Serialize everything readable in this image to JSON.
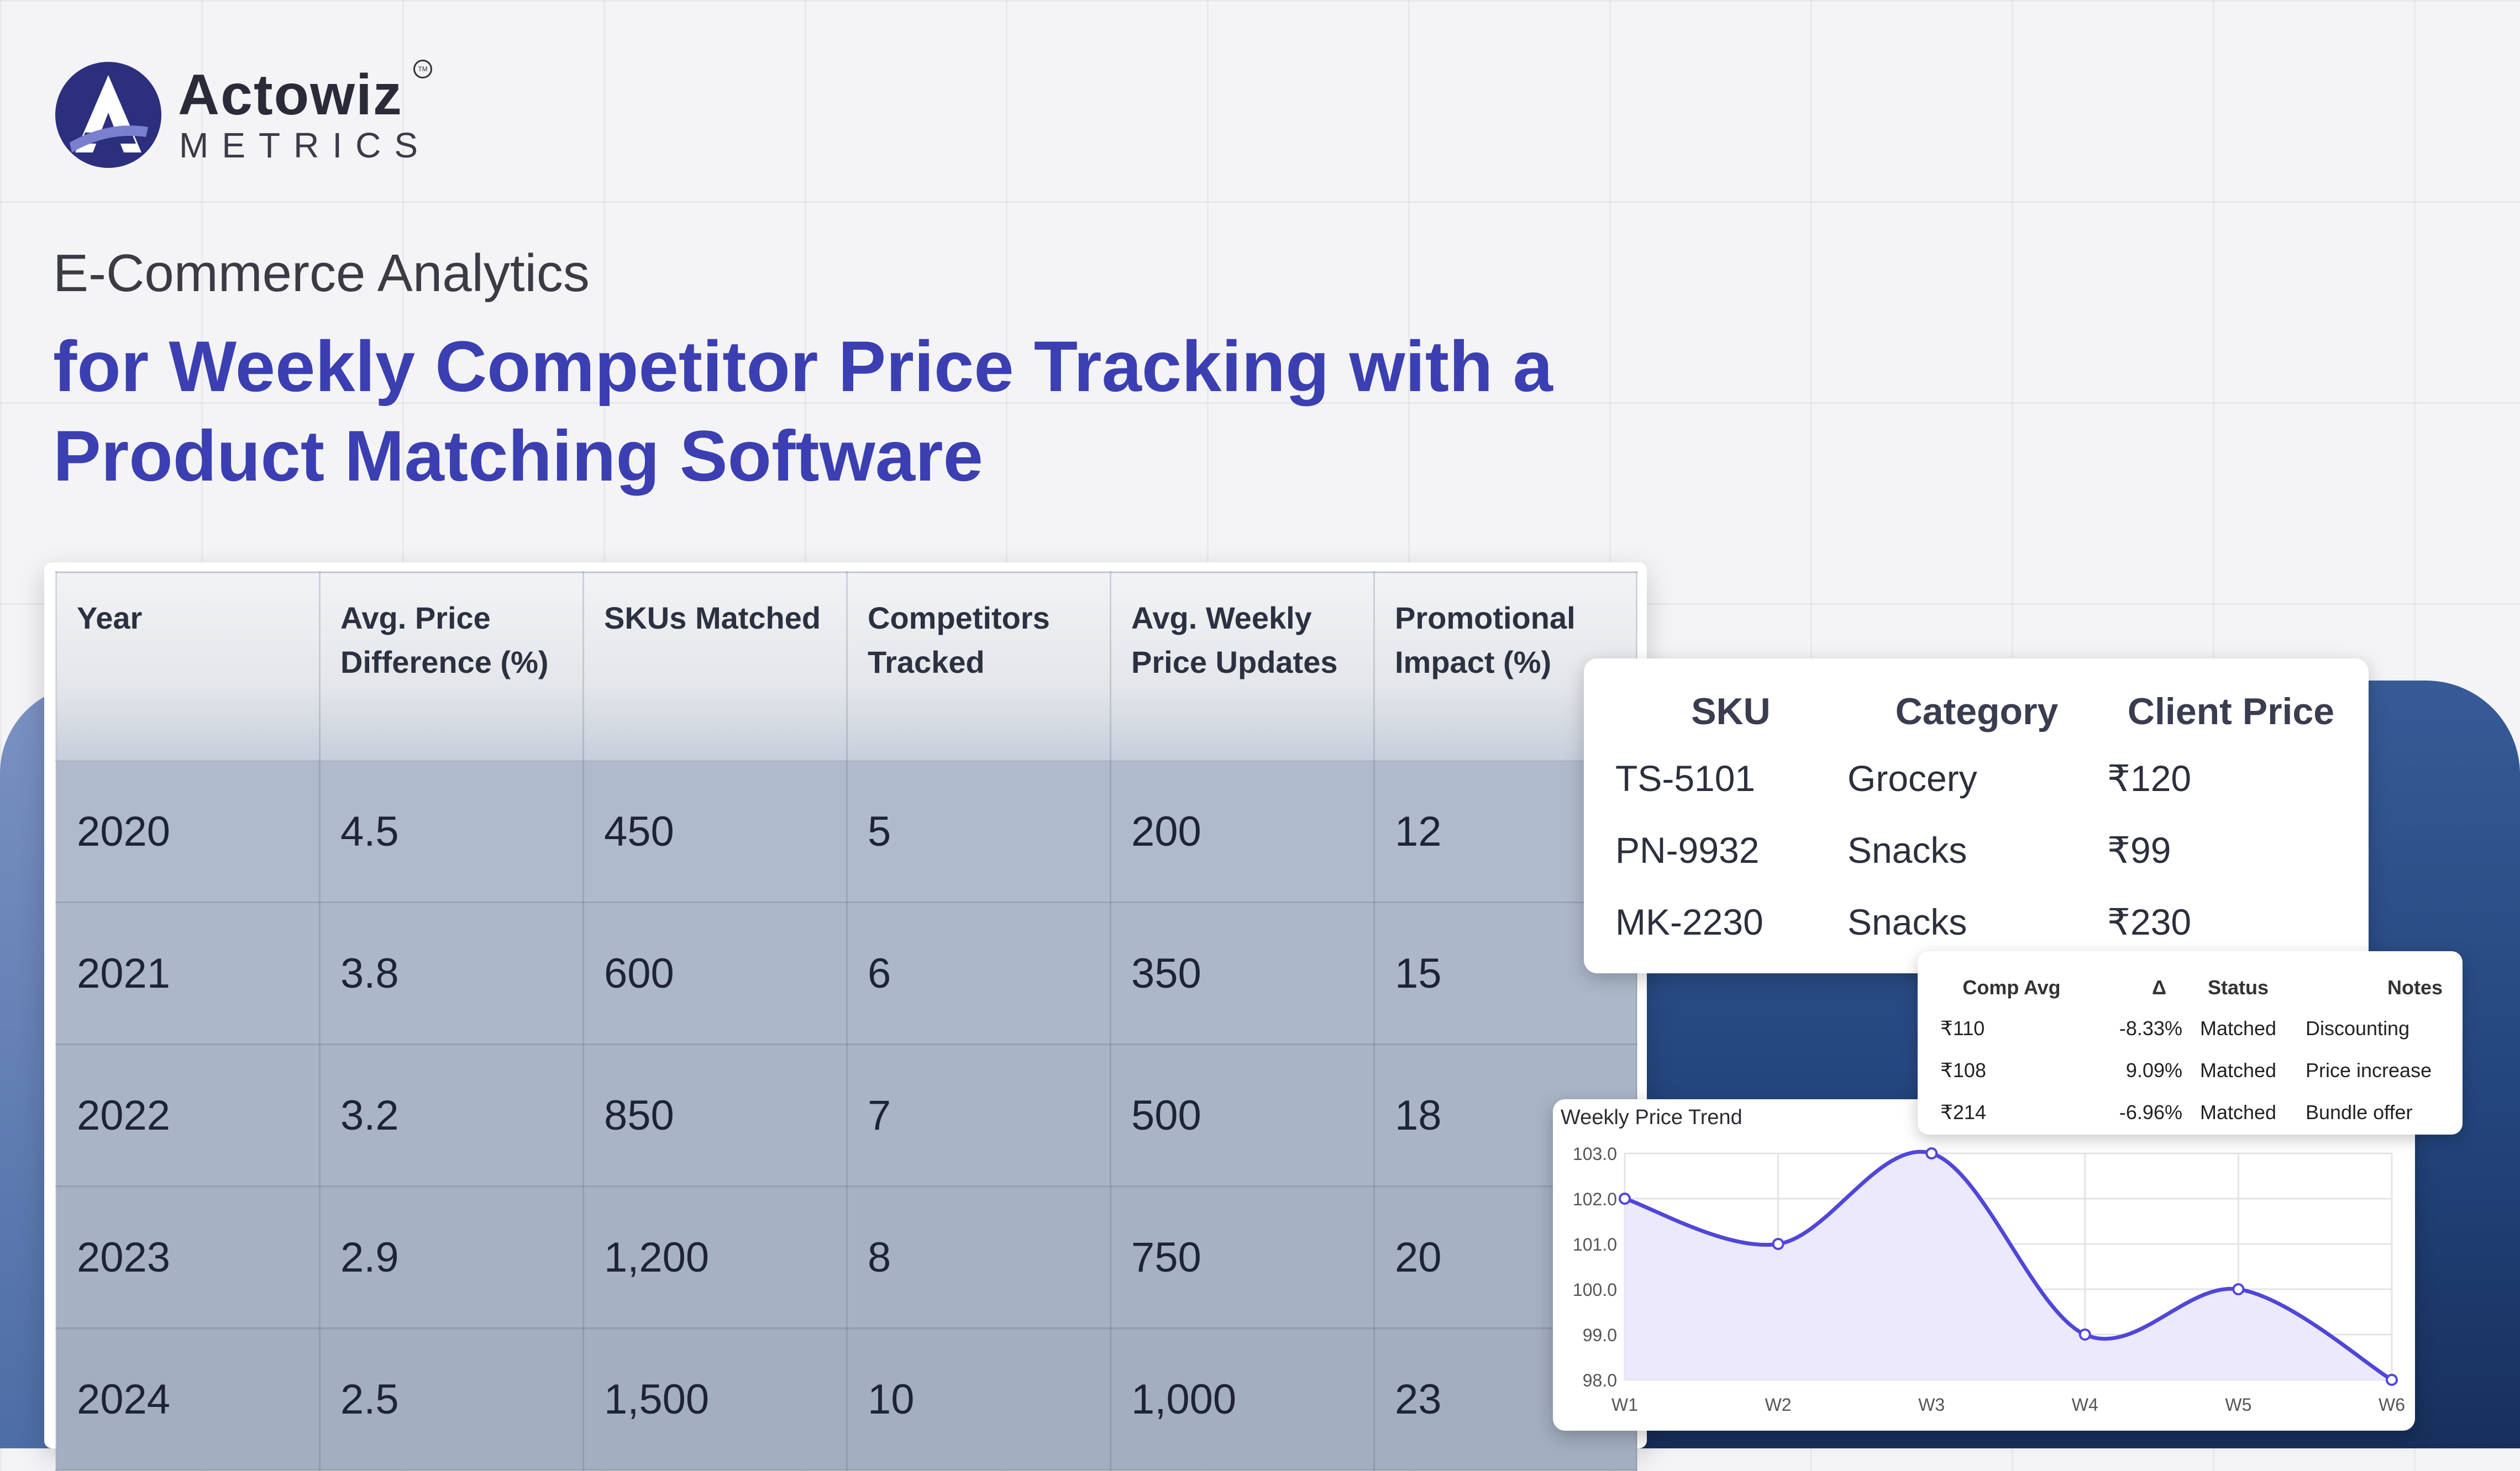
{
  "brand": {
    "name": "Actowiz",
    "sub": "METRICS",
    "logo_icon": "actowiz-a-logo-icon",
    "tm": "TM"
  },
  "header": {
    "subtitle": "E-Commerce Analytics",
    "headline": "for Weekly Competitor Price Tracking with a Product Matching Software"
  },
  "main_table": {
    "columns": [
      "Year",
      "Avg. Price Difference (%)",
      "SKUs Matched",
      "Competitors Tracked",
      "Avg. Weekly Price Updates",
      "Promotional Impact (%)"
    ],
    "rows": [
      [
        "2020",
        "4.5",
        "450",
        "5",
        "200",
        "12"
      ],
      [
        "2021",
        "3.8",
        "600",
        "6",
        "350",
        "15"
      ],
      [
        "2022",
        "3.2",
        "850",
        "7",
        "500",
        "18"
      ],
      [
        "2023",
        "2.9",
        "1,200",
        "8",
        "750",
        "20"
      ],
      [
        "2024",
        "2.5",
        "1,500",
        "10",
        "1,000",
        "23"
      ]
    ]
  },
  "sku_table": {
    "columns": [
      "SKU",
      "Category",
      "Client Price"
    ],
    "rows": [
      [
        "TS-5101",
        "Grocery",
        "₹120"
      ],
      [
        "PN-9932",
        "Snacks",
        "₹99"
      ],
      [
        "MK-2230",
        "Snacks",
        "₹230"
      ]
    ]
  },
  "comp_table": {
    "columns": [
      "Comp Avg",
      "Δ",
      "Status",
      "Notes"
    ],
    "rows": [
      [
        "₹110",
        "-8.33%",
        "Matched",
        "Discounting"
      ],
      [
        "₹108",
        "9.09%",
        "Matched",
        "Price increase"
      ],
      [
        "₹214",
        "-6.96%",
        "Matched",
        "Bundle offer"
      ]
    ]
  },
  "chart_data": {
    "type": "area",
    "title": "Weekly Price Trend",
    "categories": [
      "W1",
      "W2",
      "W3",
      "W4",
      "W5",
      "W6"
    ],
    "values": [
      102,
      101,
      103,
      99,
      100,
      98
    ],
    "ylim": [
      98,
      103
    ],
    "yticks": [
      "103.0",
      "102.0",
      "101.0",
      "100.0",
      "99.0",
      "98.0"
    ],
    "xlabel": "",
    "ylabel": "",
    "grid": true,
    "colors": {
      "line": "#5046d8",
      "fill": "#ebe9fb",
      "grid": "#e4e4e8",
      "tick_text": "#555"
    }
  },
  "colors": {
    "accent": "#3b3fb2",
    "panel_dark": "#23457d"
  }
}
